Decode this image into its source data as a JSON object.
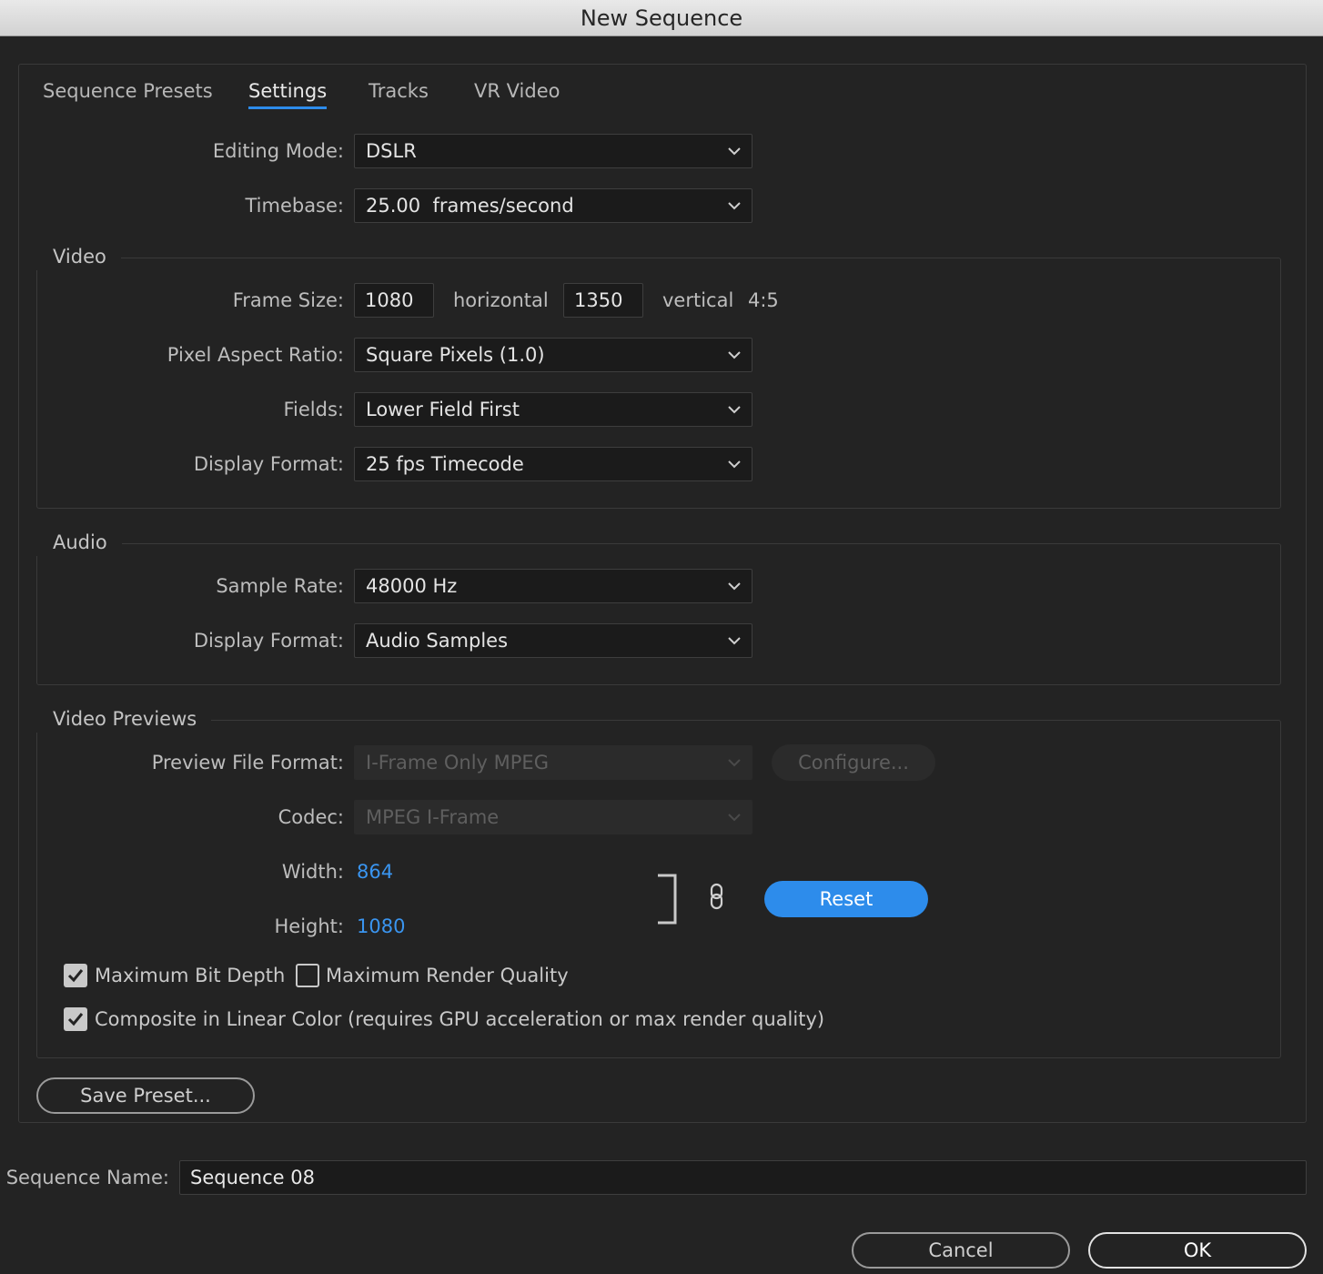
{
  "window": {
    "title": "New Sequence"
  },
  "tabs": [
    {
      "label": "Sequence Presets",
      "active": false
    },
    {
      "label": "Settings",
      "active": true
    },
    {
      "label": "Tracks",
      "active": false
    },
    {
      "label": "VR Video",
      "active": false
    }
  ],
  "settings": {
    "editing_mode": {
      "label": "Editing Mode:",
      "value": "DSLR"
    },
    "timebase": {
      "label": "Timebase:",
      "value": "25.00  frames/second"
    }
  },
  "video": {
    "title": "Video",
    "frame_size": {
      "label": "Frame Size:",
      "horizontal": "1080",
      "horizontal_label": "horizontal",
      "vertical": "1350",
      "vertical_label": "vertical",
      "aspect": "4:5"
    },
    "pixel_aspect_ratio": {
      "label": "Pixel Aspect Ratio:",
      "value": "Square Pixels (1.0)"
    },
    "fields": {
      "label": "Fields:",
      "value": "Lower Field First"
    },
    "display_format": {
      "label": "Display Format:",
      "value": "25 fps Timecode"
    }
  },
  "audio": {
    "title": "Audio",
    "sample_rate": {
      "label": "Sample Rate:",
      "value": "48000 Hz"
    },
    "display_format": {
      "label": "Display Format:",
      "value": "Audio Samples"
    }
  },
  "previews": {
    "title": "Video Previews",
    "preview_file_format": {
      "label": "Preview File Format:",
      "value": "I-Frame Only MPEG"
    },
    "configure_label": "Configure...",
    "codec": {
      "label": "Codec:",
      "value": "MPEG I-Frame"
    },
    "width": {
      "label": "Width:",
      "value": "864"
    },
    "height": {
      "label": "Height:",
      "value": "1080"
    },
    "reset_label": "Reset",
    "max_bit_depth": {
      "label": "Maximum Bit Depth",
      "checked": true
    },
    "max_render_quality": {
      "label": "Maximum Render Quality",
      "checked": false
    },
    "linear_color": {
      "label": "Composite in Linear Color (requires GPU acceleration or max render quality)",
      "checked": true
    }
  },
  "save_preset_label": "Save Preset...",
  "sequence_name": {
    "label": "Sequence Name:",
    "value": "Sequence 08"
  },
  "buttons": {
    "cancel": "Cancel",
    "ok": "OK"
  },
  "colors": {
    "accent": "#2d8ceb",
    "background": "#232323",
    "link": "#3a95f0"
  }
}
